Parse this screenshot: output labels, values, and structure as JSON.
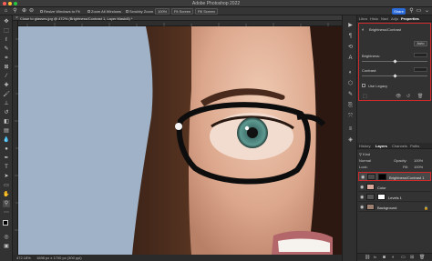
{
  "app": {
    "title": "Adobe Photoshop 2022",
    "window_buttons": [
      "close",
      "minimize",
      "zoom"
    ],
    "colors": {
      "close": "#ff5f57",
      "minimize": "#febc2e",
      "zoom": "#28c840",
      "accent": "#2b6ad9",
      "highlight": "#d02929"
    }
  },
  "options_bar": {
    "tool_icon": "zoom-icon",
    "resize_windows_label": "Resize Windows to Fit",
    "zoom_all_label": "Zoom All Windows",
    "scrubby_zoom_label": "Scrubby Zoom",
    "zoom_100_label": "100%",
    "fit_screen_label": "Fit Screen",
    "fill_screen_label": "Fill Screen",
    "share_label": "Share"
  },
  "document": {
    "tab_label": "Close to glasses.jpg @ 472% (Brightness/Contrast 1, Layer Mask/8) *",
    "status_zoom": "472.18%",
    "status_size": "1698 px x 1700 px (300 ppi)"
  },
  "tools": [
    "move-icon",
    "marquee-icon",
    "lasso-icon",
    "quick-select-icon",
    "crop-icon",
    "frame-icon",
    "eyedropper-icon",
    "healing-icon",
    "brush-icon",
    "stamp-icon",
    "history-brush-icon",
    "eraser-icon",
    "gradient-icon",
    "blur-icon",
    "dodge-icon",
    "pen-icon",
    "type-icon",
    "path-select-icon",
    "shape-icon",
    "hand-icon",
    "zoom-icon",
    "more-tools-icon"
  ],
  "dock_icons": [
    "play-icon",
    "paragraph-icon",
    "history-icon",
    "character-icon",
    "adjust-icon",
    "cube-icon",
    "brush-settings-icon",
    "clone-source-icon",
    "transform-icon",
    "layers-icon",
    "channels-icon"
  ],
  "properties_panel": {
    "tabs": [
      "Libra",
      "Histo",
      "Navi",
      "Adju",
      "Properties"
    ],
    "active_tab": "Properties",
    "adjustment_name": "Brightness/Contrast",
    "auto_label": "Auto",
    "brightness_label": "Brightness:",
    "brightness_value": "",
    "brightness_level": 0.5,
    "contrast_label": "Contrast:",
    "contrast_value": "",
    "contrast_level": 0.5,
    "use_legacy_label": "Use Legacy",
    "use_legacy_checked": false
  },
  "layers_panel": {
    "tabs": [
      "History",
      "Layers",
      "Channels",
      "Paths"
    ],
    "active_tab": "Layers",
    "filter_label": "Kind",
    "blend_mode": "Normal",
    "opacity_label": "Opacity:",
    "opacity_value": "100%",
    "lock_label": "Lock:",
    "fill_label": "Fill:",
    "fill_value": "100%",
    "layers": [
      {
        "name": "Brightness/Contrast 1",
        "selected": true,
        "kind": "adjustment"
      },
      {
        "name": "Color",
        "selected": false,
        "kind": "color"
      },
      {
        "name": "Levels 1",
        "selected": false,
        "kind": "adjustment"
      },
      {
        "name": "Background",
        "selected": false,
        "kind": "image"
      }
    ],
    "footer_icons": [
      "link-icon",
      "fx-icon",
      "mask-icon",
      "adjustment-icon",
      "folder-icon",
      "new-layer-icon",
      "trash-icon"
    ]
  }
}
